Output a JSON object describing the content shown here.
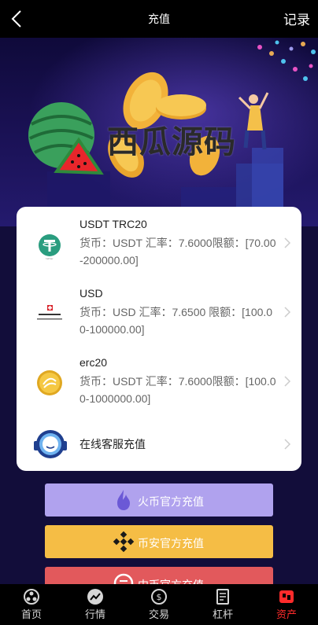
{
  "header": {
    "title": "充值",
    "records_label": "记录"
  },
  "banner": {
    "watermark": "西瓜源码"
  },
  "methods": [
    {
      "name": "USDT TRC20",
      "detail": "货币：USDT 汇率：7.6000限额：[70.00-200000.00]",
      "icon": "tether-icon"
    },
    {
      "name": "USD",
      "detail": "货币：USD 汇率：7.6500 限额：[100.00-100000.00]",
      "icon": "bank-logo-icon"
    },
    {
      "name": "erc20",
      "detail": "货币：USDT 汇率：7.6000限额：[100.00-1000000.00]",
      "icon": "gold-coin-icon"
    },
    {
      "name": "在线客服充值",
      "icon": "customer-service-icon"
    }
  ],
  "buttons": {
    "huobi": {
      "label": "火币官方充值",
      "color": "#b0a2ee"
    },
    "binance": {
      "label": "币安官方充值",
      "color": "#f5bd45"
    },
    "third": {
      "label": "中币官方充值",
      "color": "#e2595c"
    }
  },
  "tabs": [
    {
      "label": "首页",
      "icon": "home-icon"
    },
    {
      "label": "行情",
      "icon": "chart-icon"
    },
    {
      "label": "交易",
      "icon": "exchange-icon"
    },
    {
      "label": "杠杆",
      "icon": "leverage-icon"
    },
    {
      "label": "资产",
      "icon": "assets-icon",
      "active": true
    }
  ],
  "colors": {
    "active_tab": "#ff2b2b",
    "header_bg": "#000000"
  }
}
